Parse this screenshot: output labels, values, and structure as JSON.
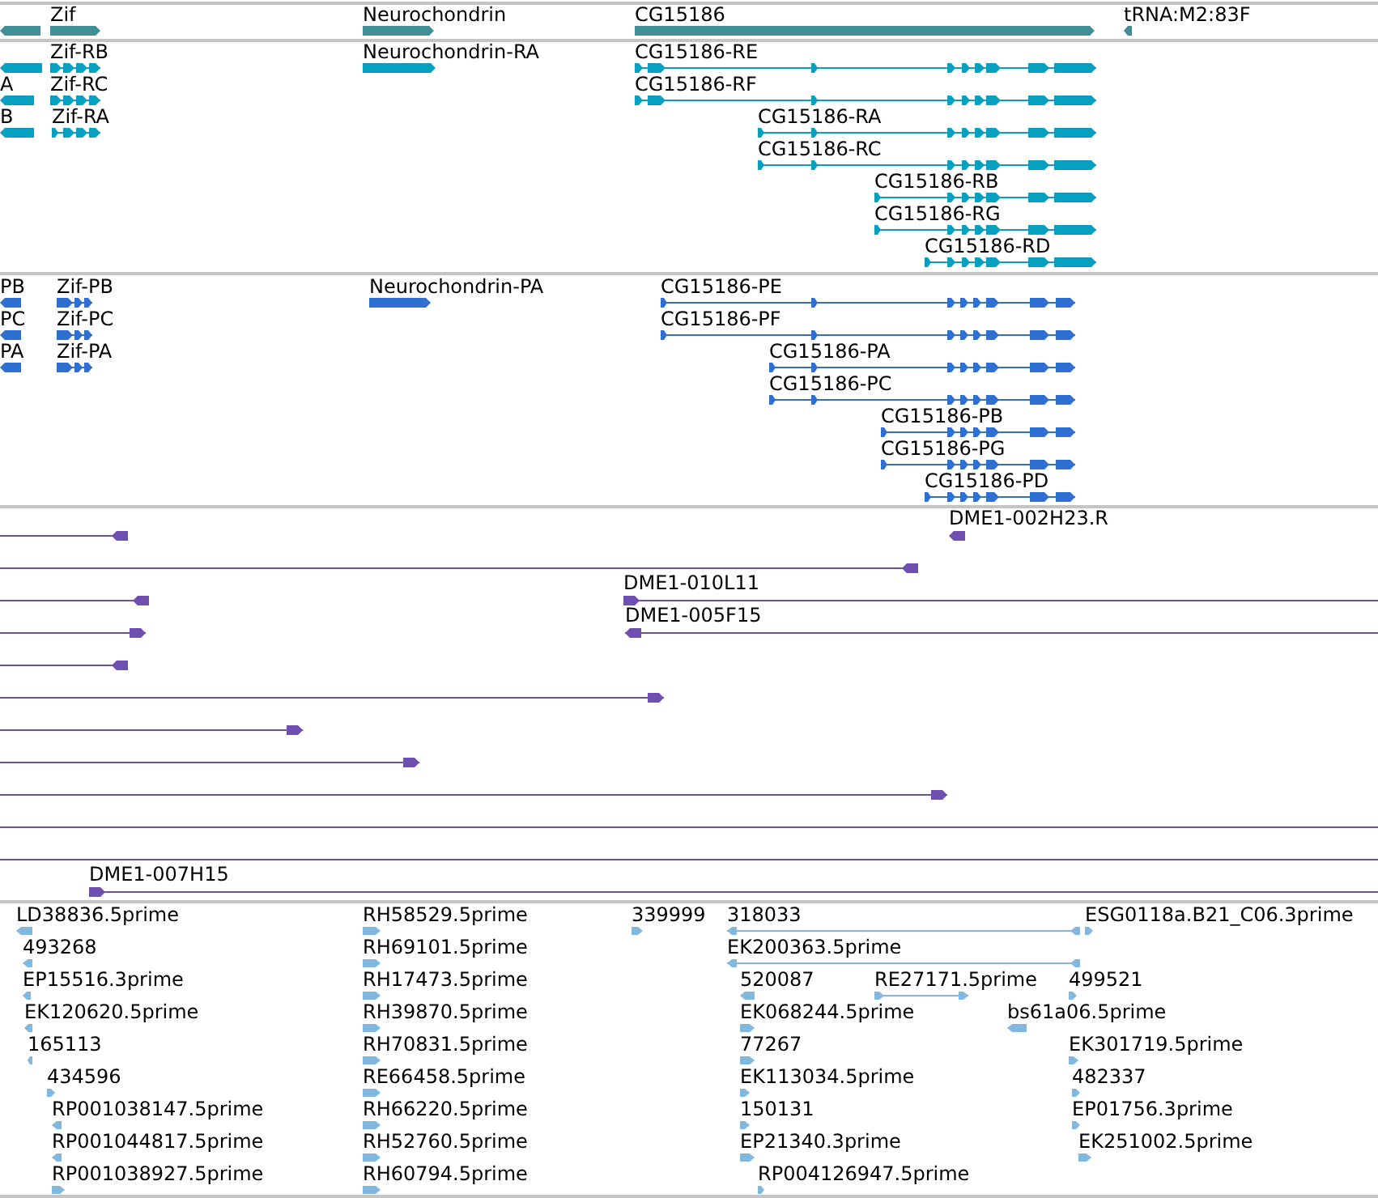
{
  "tracks": [
    {
      "kind": "gene",
      "color": "#3f8f95",
      "features": [
        {
          "reverse": true
        },
        {
          "label": "Zif",
          "reverse": false
        },
        {
          "label": "Neurochondrin",
          "reverse": false
        },
        {
          "label": "CG15186",
          "reverse": false
        },
        {
          "label": "tRNA:M2:83F",
          "reverse": true
        }
      ]
    },
    {
      "kind": "transcript",
      "color": "#08a0c0",
      "features": [
        {
          "reverse": true
        },
        {
          "label": "Zif-RB",
          "reverse": false
        },
        {
          "label": "Neurochondrin-RA",
          "reverse": false
        },
        {
          "label": "CG15186-RE",
          "reverse": false
        },
        {
          "label": "A",
          "reverse": true
        },
        {
          "label": "Zif-RC",
          "reverse": false
        },
        {
          "label": "CG15186-RF",
          "reverse": false
        },
        {
          "label": "B",
          "reverse": true
        },
        {
          "label": "Zif-RA",
          "reverse": false
        },
        {
          "label": "CG15186-RA",
          "reverse": false
        },
        {
          "label": "CG15186-RC",
          "reverse": false
        },
        {
          "label": "CG15186-RB",
          "reverse": false
        },
        {
          "label": "CG15186-RG",
          "reverse": false
        },
        {
          "label": "CG15186-RD",
          "reverse": false
        }
      ]
    },
    {
      "kind": "protein",
      "color": "#2f6fd0",
      "features": [
        {
          "label": "PB",
          "reverse": true
        },
        {
          "label": "Zif-PB",
          "reverse": false
        },
        {
          "label": "Neurochondrin-PA",
          "reverse": false
        },
        {
          "label": "CG15186-PE",
          "reverse": false
        },
        {
          "label": "PC",
          "reverse": true
        },
        {
          "label": "Zif-PC",
          "reverse": false
        },
        {
          "label": "CG15186-PF",
          "reverse": false
        },
        {
          "label": "PA",
          "reverse": true
        },
        {
          "label": "Zif-PA",
          "reverse": false
        },
        {
          "label": "CG15186-PA",
          "reverse": false
        },
        {
          "label": "CG15186-PC",
          "reverse": false
        },
        {
          "label": "CG15186-PB",
          "reverse": false
        },
        {
          "label": "CG15186-PG",
          "reverse": false
        },
        {
          "label": "CG15186-PD",
          "reverse": false
        }
      ]
    },
    {
      "kind": "clone",
      "color": "#6f50b0",
      "features": [
        {
          "reverse": true,
          "arrow": true
        },
        {
          "label": "DME1-002H23.R",
          "reverse": true,
          "arrow": true
        },
        {
          "reverse": true,
          "arrow": true
        },
        {
          "reverse": true,
          "arrow": true
        },
        {
          "label": "DME1-010L11",
          "reverse": false,
          "arrow": true
        },
        {
          "reverse": false,
          "arrow": true
        },
        {
          "label": "DME1-005F15",
          "reverse": true,
          "arrow": true
        },
        {
          "reverse": true,
          "arrow": true
        },
        {
          "reverse": false,
          "arrow": true
        },
        {
          "reverse": false,
          "arrow": true
        },
        {
          "reverse": false,
          "arrow": true
        },
        {
          "reverse": false,
          "arrow": true
        },
        {
          "arrow": false
        },
        {
          "arrow": false
        },
        {
          "label": "DME1-007H15",
          "reverse": false,
          "arrow": true
        }
      ]
    },
    {
      "kind": "est",
      "color": "#80b8e0",
      "features": [
        {
          "label": "LD38836.5prime",
          "reverse": true
        },
        {
          "label": "493268",
          "reverse": true
        },
        {
          "label": "EP15516.3prime",
          "reverse": true
        },
        {
          "label": "EK120620.5prime",
          "reverse": true
        },
        {
          "label": "165113",
          "reverse": true
        },
        {
          "label": "434596",
          "reverse": false
        },
        {
          "label": "RP001038147.5prime",
          "reverse": true
        },
        {
          "label": "RP001044817.5prime",
          "reverse": true
        },
        {
          "label": "RP001038927.5prime",
          "reverse": false
        },
        {
          "label": "RH58529.5prime",
          "reverse": false
        },
        {
          "label": "RH69101.5prime",
          "reverse": false
        },
        {
          "label": "RH17473.5prime",
          "reverse": false
        },
        {
          "label": "RH39870.5prime",
          "reverse": false
        },
        {
          "label": "RH70831.5prime",
          "reverse": false
        },
        {
          "label": "RE66458.5prime",
          "reverse": false
        },
        {
          "label": "RH66220.5prime",
          "reverse": false
        },
        {
          "label": "RH52760.5prime",
          "reverse": false
        },
        {
          "label": "RH60794.5prime",
          "reverse": false
        },
        {
          "label": "339999",
          "reverse": false
        },
        {
          "label": "318033",
          "reverse": true
        },
        {
          "label": "ESG0118a.B21_C06.3prime",
          "reverse": false
        },
        {
          "label": "EK200363.5prime",
          "reverse": true
        },
        {
          "label": "520087",
          "reverse": true
        },
        {
          "label": "RE27171.5prime",
          "reverse": false
        },
        {
          "label": "499521",
          "reverse": false
        },
        {
          "label": "EK068244.5prime",
          "reverse": false
        },
        {
          "label": "bs61a06.5prime",
          "reverse": true
        },
        {
          "label": "77267",
          "reverse": false
        },
        {
          "label": "EK301719.5prime",
          "reverse": false
        },
        {
          "label": "EK113034.5prime",
          "reverse": false
        },
        {
          "label": "482337",
          "reverse": false
        },
        {
          "label": "150131",
          "reverse": false
        },
        {
          "label": "EP01756.3prime",
          "reverse": false
        },
        {
          "label": "EP21340.3prime",
          "reverse": false
        },
        {
          "label": "EK251002.5prime",
          "reverse": false
        },
        {
          "label": "RP004126947.5prime",
          "reverse": false
        }
      ]
    }
  ]
}
